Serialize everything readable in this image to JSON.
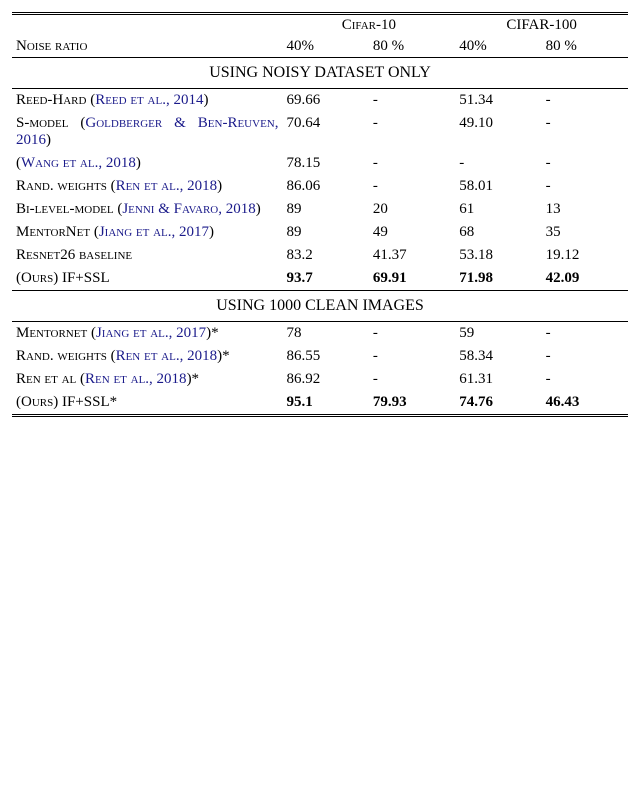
{
  "header": {
    "noise_ratio": "Noise ratio",
    "cifar10": "Cifar-10",
    "cifar100": "CIFAR-100",
    "p40": "40%",
    "p80a": "80 %",
    "p40b": "40%",
    "p80b": "80 %"
  },
  "sections": {
    "noisy": "USING NOISY DATASET ONLY",
    "clean": "USING 1000 CLEAN IMAGES"
  },
  "methods": {
    "reed": {
      "name": "Reed-Hard",
      "open": "(",
      "cite": "Reed et al., 2014",
      "close": ")"
    },
    "smodel": {
      "name": "S-model",
      "open": "(",
      "cite": "Goldberger & Ben-Reuven, 2016",
      "close": ")"
    },
    "wang": {
      "open": "(",
      "cite": "Wang et al., 2018",
      "close": ")"
    },
    "rand": {
      "name": "Rand. weights",
      "open": "(",
      "cite": "Ren et al., 2018",
      "close": ")"
    },
    "bilevel": {
      "name": "Bi-level-model",
      "open": "(",
      "cite": "Jenni & Favaro, 2018",
      "close": ")"
    },
    "mentor": {
      "name": "MentorNet",
      "open": "(",
      "cite": "Jiang et al., 2017",
      "close": ")"
    },
    "resnet": {
      "name": "Resnet26 baseline"
    },
    "ours": {
      "name": "(Ours) IF+SSL"
    },
    "mentor2": {
      "name": "Mentornet",
      "open": "(",
      "cite": "Jiang et al., 2017",
      "close": ")*"
    },
    "rand2": {
      "name": "Rand. weights",
      "open": "(",
      "cite": "Ren et al., 2018",
      "close": ")*"
    },
    "ren2": {
      "name": "Ren et al",
      "open": "(",
      "cite": "Ren et al., 2018",
      "close": ")*"
    },
    "ours2": {
      "name": "(Ours) IF+SSL*"
    }
  },
  "chart_data": {
    "type": "table",
    "columns": [
      "CIFAR-10 40%",
      "CIFAR-10 80%",
      "CIFAR-100 40%",
      "CIFAR-100 80%"
    ],
    "rows_noisy": {
      "reed": [
        "69.66",
        "-",
        "51.34",
        "-"
      ],
      "smodel": [
        "70.64",
        "-",
        "49.10",
        "-"
      ],
      "wang": [
        "78.15",
        "-",
        "-",
        "-"
      ],
      "rand": [
        "86.06",
        "-",
        "58.01",
        "-"
      ],
      "bilevel": [
        "89",
        "20",
        "61",
        "13"
      ],
      "mentor": [
        "89",
        "49",
        "68",
        "35"
      ],
      "resnet": [
        "83.2",
        "41.37",
        "53.18",
        "19.12"
      ],
      "ours": [
        "93.7",
        "69.91",
        "71.98",
        "42.09"
      ]
    },
    "rows_clean": {
      "mentor2": [
        "78",
        "-",
        "59",
        "-"
      ],
      "rand2": [
        "86.55",
        "-",
        "58.34",
        "-"
      ],
      "ren2": [
        "86.92",
        "-",
        "61.31",
        "-"
      ],
      "ours2": [
        "95.1",
        "79.93",
        "74.76",
        "46.43"
      ]
    }
  }
}
